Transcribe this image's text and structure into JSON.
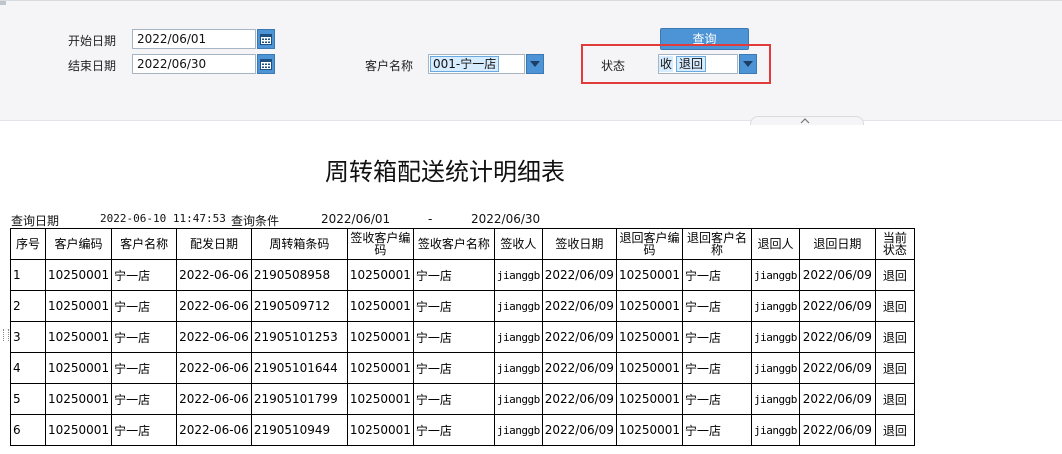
{
  "filters": {
    "start_date_label": "开始日期",
    "start_date_value": "2022/06/01",
    "end_date_label": "结束日期",
    "end_date_value": "2022/06/30",
    "customer_label": "客户名称",
    "customer_value": "001-宁一店",
    "status_label": "状态",
    "status_value_partial": "收",
    "status_value_tag": "退回",
    "query_button": "查询"
  },
  "report": {
    "title": "周转箱配送统计明细表",
    "query_date_label": "查询日期",
    "query_date_value": "2022-06-10 11:47:53",
    "query_cond_label": "查询条件",
    "cond_start": "2022/06/01",
    "cond_sep": "-",
    "cond_end": "2022/06/30",
    "columns": [
      "序号",
      "客户编码",
      "客户名称",
      "配发日期",
      "周转箱条码",
      "签收客户编码",
      "签收客户名称",
      "签收人",
      "签收日期",
      "退回客户编码",
      "退回客户名称",
      "退回人",
      "退回日期",
      "当前状态"
    ],
    "rows": [
      [
        "1",
        "10250001",
        "宁一店",
        "2022-06-06",
        "2190508958",
        "10250001",
        "宁一店",
        "jianggb",
        "2022/06/09",
        "10250001",
        "宁一店",
        "jianggb",
        "2022/06/09",
        "退回"
      ],
      [
        "2",
        "10250001",
        "宁一店",
        "2022-06-06",
        "2190509712",
        "10250001",
        "宁一店",
        "jianggb",
        "2022/06/09",
        "10250001",
        "宁一店",
        "jianggb",
        "2022/06/09",
        "退回"
      ],
      [
        "3",
        "10250001",
        "宁一店",
        "2022-06-06",
        "21905101253",
        "10250001",
        "宁一店",
        "jianggb",
        "2022/06/09",
        "10250001",
        "宁一店",
        "jianggb",
        "2022/06/09",
        "退回"
      ],
      [
        "4",
        "10250001",
        "宁一店",
        "2022-06-06",
        "21905101644",
        "10250001",
        "宁一店",
        "jianggb",
        "2022/06/09",
        "10250001",
        "宁一店",
        "jianggb",
        "2022/06/09",
        "退回"
      ],
      [
        "5",
        "10250001",
        "宁一店",
        "2022-06-06",
        "21905101799",
        "10250001",
        "宁一店",
        "jianggb",
        "2022/06/09",
        "10250001",
        "宁一店",
        "jianggb",
        "2022/06/09",
        "退回"
      ],
      [
        "6",
        "10250001",
        "宁一店",
        "2022-06-06",
        "2190510949",
        "10250001",
        "宁一店",
        "jianggb",
        "2022/06/09",
        "10250001",
        "宁一店",
        "jianggb",
        "2022/06/09",
        "退回"
      ]
    ]
  },
  "colors": {
    "accent": "#4d94d6",
    "highlight": "#e23b3b"
  }
}
